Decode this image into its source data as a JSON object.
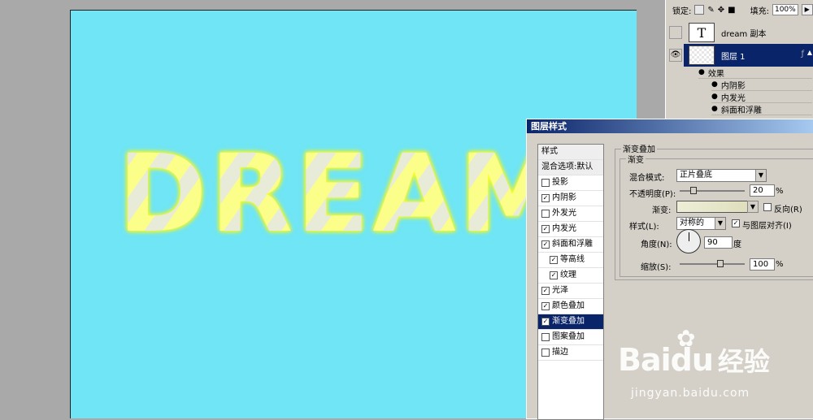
{
  "canvas": {
    "text": "DREAM"
  },
  "layers_panel": {
    "lock_label": "锁定:",
    "fill_label": "填充:",
    "fill_value": "100%",
    "layers": [
      {
        "name": "dream 副本",
        "thumb": "T"
      },
      {
        "name": "图层 1",
        "selected": true
      }
    ],
    "effects_label": "效果",
    "effects": [
      "内阴影",
      "内发光",
      "斜面和浮雕"
    ]
  },
  "dialog": {
    "title": "图层样式",
    "styles_header": "样式",
    "blend_default": "混合选项:默认",
    "styles": [
      {
        "label": "投影",
        "checked": false
      },
      {
        "label": "内阴影",
        "checked": true
      },
      {
        "label": "外发光",
        "checked": false
      },
      {
        "label": "内发光",
        "checked": true
      },
      {
        "label": "斜面和浮雕",
        "checked": true
      },
      {
        "label": "等高线",
        "checked": true,
        "sub": true
      },
      {
        "label": "纹理",
        "checked": true,
        "sub": true
      },
      {
        "label": "光泽",
        "checked": true
      },
      {
        "label": "颜色叠加",
        "checked": true
      },
      {
        "label": "渐变叠加",
        "checked": true,
        "selected": true
      },
      {
        "label": "图案叠加",
        "checked": false
      },
      {
        "label": "描边",
        "checked": false
      }
    ],
    "panel_title": "渐变叠加",
    "group_title": "渐变",
    "blend_mode_label": "混合模式:",
    "blend_mode_value": "正片叠底",
    "opacity_label": "不透明度(P):",
    "opacity_value": "20",
    "percent": "%",
    "gradient_label": "渐变:",
    "reverse_label": "反向(R)",
    "style_label": "样式(L):",
    "style_value": "对称的",
    "align_label": "与图层对齐(I)",
    "angle_label": "角度(N):",
    "angle_value": "90",
    "degree": "度",
    "scale_label": "缩放(S):",
    "scale_value": "100"
  },
  "watermark": {
    "logo": "Baidu",
    "cn": "经验",
    "url": "jingyan.baidu.com"
  }
}
